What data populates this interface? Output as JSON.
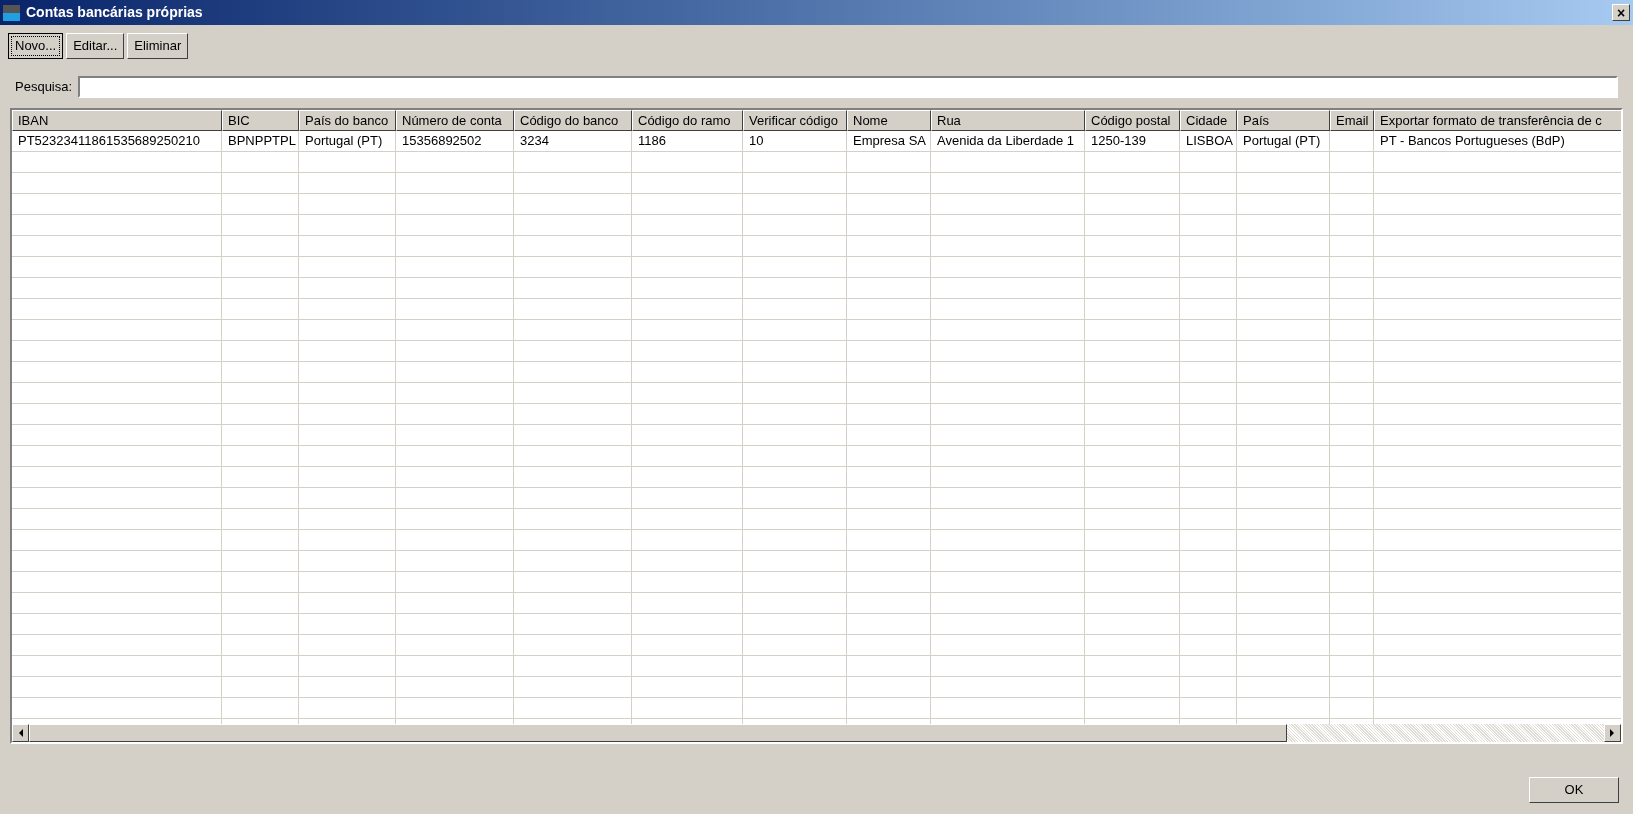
{
  "window": {
    "title": "Contas bancárias próprias",
    "close": "×"
  },
  "toolbar": [
    {
      "label": "Novo...",
      "focused": true
    },
    {
      "label": "Editar...",
      "focused": false
    },
    {
      "label": "Eliminar",
      "focused": false
    }
  ],
  "search": {
    "label": "Pesquisa:"
  },
  "table": {
    "columns": [
      "IBAN",
      "BIC",
      "País do banco",
      "Número de conta",
      "Código do banco",
      "Código do ramo",
      "Verificar código",
      "Nome",
      "Rua",
      "Código postal",
      "Cidade",
      "País",
      "Email",
      "Exportar formato de transferência de c"
    ],
    "rows": [
      {
        "selected": false,
        "cells": [
          "PT52323411861535689250210",
          "BPNPPTPL",
          "Portugal (PT)",
          "15356892502",
          "3234",
          "1186",
          "10",
          "Empresa SA",
          "Avenida da Liberdade 1",
          "1250-139",
          "LISBOA",
          "Portugal (PT)",
          "",
          "PT - Bancos Portugueses (BdP)"
        ]
      }
    ]
  },
  "ok_button": "OK"
}
